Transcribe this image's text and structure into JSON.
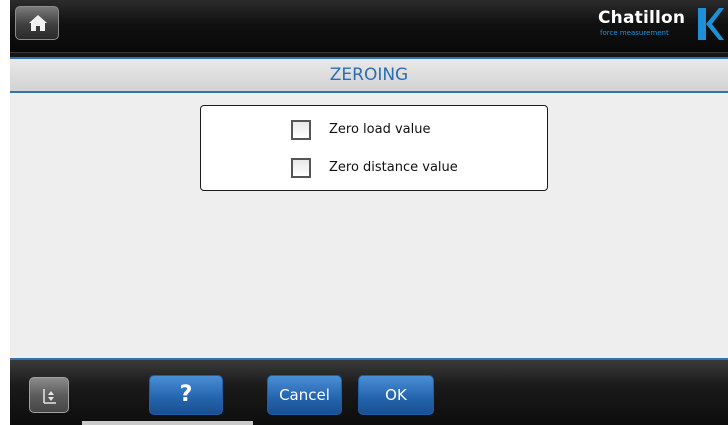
{
  "topbar": {
    "home_icon": "home-icon",
    "brand": {
      "name": "Chatillon",
      "tagline": "force measurement",
      "mark_color": "#1e90d8"
    }
  },
  "screen": {
    "title": "ZEROING"
  },
  "options": [
    {
      "label": "Zero load value",
      "checked": false
    },
    {
      "label": "Zero distance value",
      "checked": false
    }
  ],
  "footer": {
    "scroll_icon": "scroll-updown-icon",
    "help_label": "?",
    "cancel_label": "Cancel",
    "ok_label": "OK"
  },
  "colors": {
    "accent": "#2f73b5",
    "title_text": "#2a6fb3",
    "button_blue": "#2566b0"
  }
}
